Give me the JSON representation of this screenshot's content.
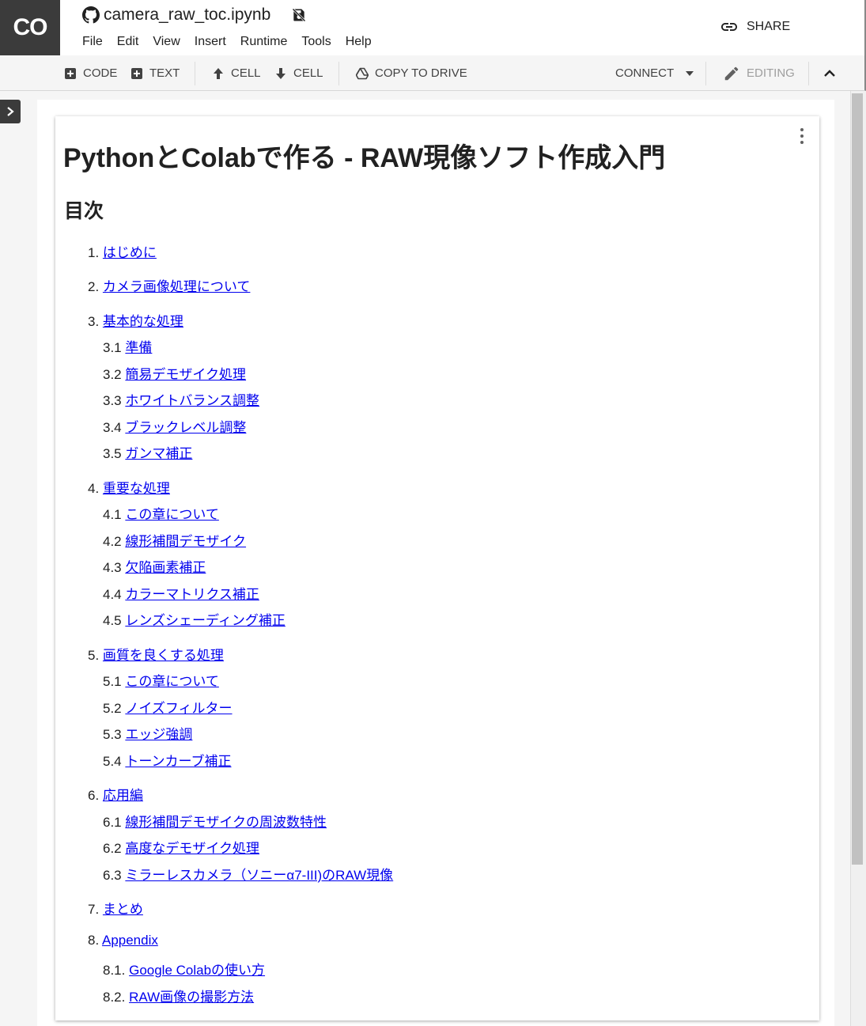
{
  "app": {
    "logo": "CO",
    "filename": "camera_raw_toc.ipynb",
    "menu": [
      "File",
      "Edit",
      "View",
      "Insert",
      "Runtime",
      "Tools",
      "Help"
    ],
    "share_label": "SHARE"
  },
  "toolbar": {
    "code_label": "CODE",
    "text_label": "TEXT",
    "cell_up_label": "CELL",
    "cell_down_label": "CELL",
    "copy_label": "COPY TO DRIVE",
    "connect_label": "CONNECT",
    "editing_label": "EDITING"
  },
  "notebook": {
    "title": "PythonとColabで作る - RAW現像ソフト作成入門",
    "toc_heading": "目次",
    "toc": [
      {
        "num": "1.",
        "text": "はじめに"
      },
      {
        "num": "2.",
        "text": "カメラ画像処理について"
      },
      {
        "num": "3.",
        "text": "基本的な処理"
      },
      {
        "num": "3.1",
        "text": "準備"
      },
      {
        "num": "3.2",
        "text": "簡易デモザイク処理"
      },
      {
        "num": "3.3",
        "text": "ホワイトバランス調整"
      },
      {
        "num": "3.4",
        "text": "ブラックレベル調整"
      },
      {
        "num": "3.5",
        "text": "ガンマ補正"
      },
      {
        "num": "4.",
        "text": "重要な処理"
      },
      {
        "num": "4.1",
        "text": "この章について"
      },
      {
        "num": "4.2",
        "text": "線形補間デモザイク"
      },
      {
        "num": "4.3",
        "text": "欠陥画素補正"
      },
      {
        "num": "4.4",
        "text": "カラーマトリクス補正"
      },
      {
        "num": "4.5",
        "text": "レンズシェーディング補正"
      },
      {
        "num": "5.",
        "text": "画質を良くする処理"
      },
      {
        "num": "5.1",
        "text": "この章について"
      },
      {
        "num": "5.2",
        "text": "ノイズフィルター"
      },
      {
        "num": "5.3",
        "text": "エッジ強調"
      },
      {
        "num": "5.4",
        "text": "トーンカーブ補正"
      },
      {
        "num": "6.",
        "text": "応用編"
      },
      {
        "num": "6.1",
        "text": "線形補間デモザイクの周波数特性"
      },
      {
        "num": "6.2",
        "text": "高度なデモザイク処理"
      },
      {
        "num": "6.3",
        "text": "ミラーレスカメラ（ソニーα7-III)のRAW現像"
      },
      {
        "num": "7.",
        "text": "まとめ"
      },
      {
        "num": "8.",
        "text": "Appendix"
      },
      {
        "num": "8.1.",
        "text": "Google Colabの使い方"
      },
      {
        "num": "8.2.",
        "text": "RAW画像の撮影方法"
      }
    ]
  }
}
